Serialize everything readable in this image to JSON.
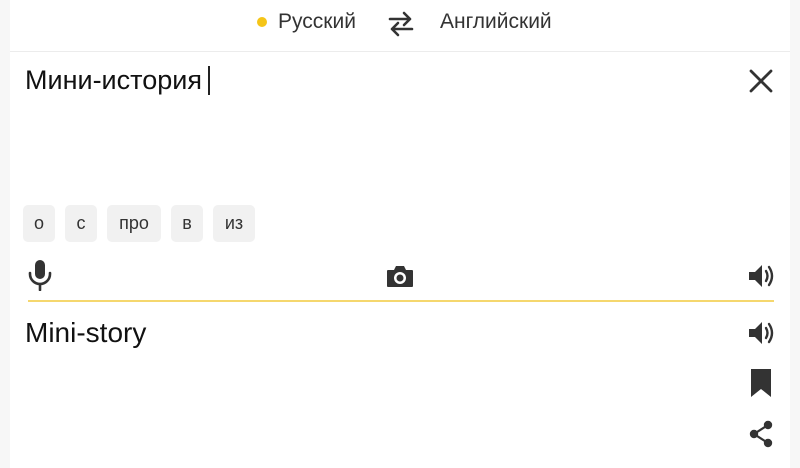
{
  "languages": {
    "source": "Русский",
    "target": "Английский"
  },
  "input": {
    "text": "Мини-история"
  },
  "suggestions": [
    "о",
    "с",
    "про",
    "в",
    "из"
  ],
  "output": {
    "text": "Mini-story"
  },
  "icons": {
    "swap": "swap-arrows-icon",
    "clear": "close-icon",
    "mic": "microphone-icon",
    "camera": "camera-icon",
    "speaker": "speaker-icon",
    "bookmark": "bookmark-icon",
    "share": "share-icon"
  },
  "colors": {
    "accent": "#f5c518",
    "divider": "#f5d76e",
    "chip_bg": "#f1f1f1"
  }
}
